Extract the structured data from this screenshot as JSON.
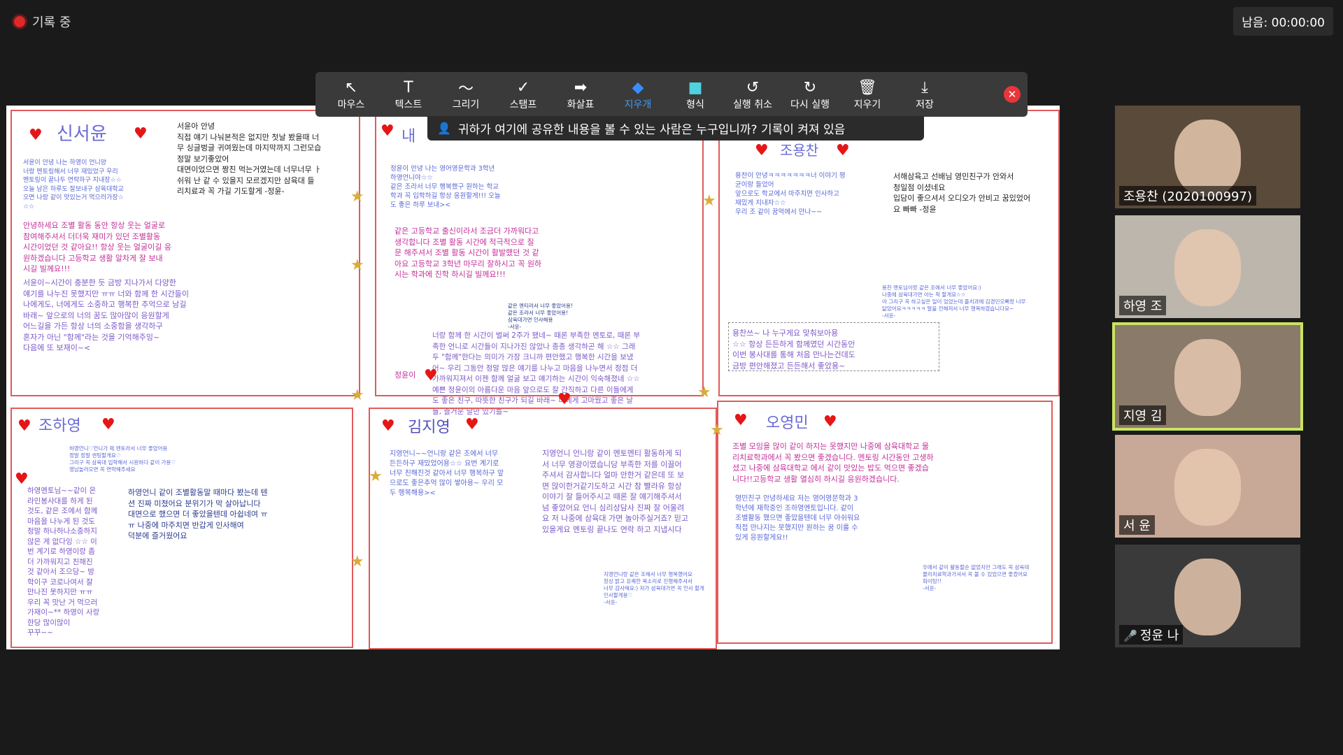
{
  "recording": {
    "label": "기록 중"
  },
  "timer": {
    "label": "남음: 00:00:00"
  },
  "toolbar": {
    "tools": [
      {
        "label": "마우스",
        "glyph": "↖"
      },
      {
        "label": "텍스트",
        "glyph": "T"
      },
      {
        "label": "그리기",
        "glyph": "〜"
      },
      {
        "label": "스탬프",
        "glyph": "✓"
      },
      {
        "label": "화살표",
        "glyph": "➡"
      },
      {
        "label": "지우개",
        "glyph": "◆"
      },
      {
        "label": "형식",
        "glyph": "■"
      },
      {
        "label": "실행 취소",
        "glyph": "↺"
      },
      {
        "label": "다시 실행",
        "glyph": "↻"
      },
      {
        "label": "지우기",
        "glyph": "🗑"
      },
      {
        "label": "저장",
        "glyph": "⤓"
      }
    ],
    "active": "지우개",
    "close_glyph": "✕"
  },
  "share_info": {
    "text": "귀하가 여기에 공유한 내용을 볼 수 있는 사람은 누구입니까? 기록이 켜져 있음"
  },
  "cards": {
    "c1": {
      "name": "신서윤",
      "t_main": "서윤이 안녕 나는 하영이 언니양\n너랑 멘토링해서 너무 재밌었구 우리\n멘토링이 끝나두 연락하구 지내장☆☆\n오늘 남은 하루도 잘보내구 삼육대학교\n오면 나랑 같이 맛있는거 먹으러가장☆\n☆☆",
      "t_top": "서윤아 안녕\n직접 얘기 나눠본적은 없지만 첫날 봤을때 너\n무 싱글벙글 귀여웠는데 마지막까지 그런모습\n정말 보기좋았어\n대면이었으면 짱친 먹는거였는데 너무너무 ㅏ\n쉬워 난 같 수 있을지 모르겠지만 삼육대 들\n리치료과 꼭 가길 기도할게 -정윤-",
      "t_pink": "안녕하세요 조별 활동 동안 항상 웃는 얼굴로\n참여해주셔서 더더욱 재미가 있던 조별활동\n시간이었던 것 같아요!! 항상 웃는 얼굴이길 응\n원하겠습니다 고등학교 생활 알차게 잘 보내\n시길 빌께요!!!",
      "t_purple": "서윤이~시간이 충분한 듯 금방 지나가서 다양한\n얘기를 나누진 못했지만 ㅠㅠ 너와 함께 한 시간들이\n나에게도, 너에게도 소중하고 행복한 추억으로 남길\n바래~ 앞으로의 너의 꿈도 많아많이 응원할게\n어느길을 가든 항상 너의 소중함을 생각하구\n혼자가 아닌 \"함께\"라는 것을 기억해주잉~\n다음에 또 보재이~<"
    },
    "c2": {
      "name": "내",
      "t_blue": "정윤이 안녕 나는 영어영문학과 3학년\n하영언니야☆☆\n같은 조라서 너무 행복했구 원하는 학교\n학과 꼭 입학하길 항상 응원할게!!! 오늘\n도 좋은 하루 보내><",
      "t_pink": "같은 고등학교 출신이라서 조금더 가까워다고\n생각합니다 조별 활동 시간에 적극적으로 질\n문 해주셔서 조별 활동 시간이 활발했던 것 같\n아요 고등학교 3학년 마무리 잘하시고 꼭 원하\n시는 학과에 진학 하시길 빌께요!!!",
      "t_tiny": "같은 멘티라서 너무 좋았어용!\n같은 조라서 너무 좋았어용!\n삼육대가면 인사해용\n-서윤-",
      "t_bottom": "너랑 함께 한 시간이 벌써 2주가 됐네~ 때론 부족한 멘토로, 때론 부\n족한 언니로 시간들이 지나가진 않았나 종종 생각하곤 해 ☆☆ 그래\n두 \"함께\"한다는 의미가 가장 크니까 편안했고 행복한 시간을 보냈\n어~ 우리 그동안 정말 많은 얘기를 나누고 마음을 나누면서 정점 더\n가까워지져서 이젠 함께 얼굴 보고 얘기하는 시간이 익숙해졌네 ☆☆\n예쁜 정윤이의 아름다운 마음 앞으로도 잘 간직하고 다른 이들에게\n도 좋은 친구, 따뜻한 친구가 되길 바래~ 너에게 고마웠고 좋은 날\n들, 즐거운 날만 있기를~",
      "label_jy": "정윤이"
    },
    "c3": {
      "name": "조용찬",
      "t_blue": "용찬이 안녕ㅋㅋㅋㅋㅋㅋㅋ너 이야기 평\n균이랑 들었어\n앞으로도 학교에서 마주치면 인사하고\n재밌게 지내자☆☆\n우리 조 같이 꿈먹에서 만나~~",
      "t_dark": "서해삼육고 선배님 영민친구가 안와서\n청일점 이셨네요\n입담이 좋으셔서 오디오가 안비고 꿈있었어\n요 빠빠 -정윤",
      "t_tiny": "용찬 멘토님이랑 같은 조에서 너무 좋았어요:)\n나중에 삼육대가면 아는 척 할게요☆☆\n아 그리구 꼭 하고싶은 일이 있었는데 졸치과에 김경민오빠랑 너무\n닮았어요ㅋㅋㅋㅋㅋ 말을 전해져서 너무 행복하였습니다요~\n-서윤-",
      "t_purple": "용찬쓰~ 나 누구게요 맞춰보아용\n☆☆ 항상 든든하게 함께였던 시간동안\n이번 봉사대를 통해 처음 만나는건데도\n금방 편안해졌고 든든해서 좋았용~"
    },
    "c4": {
      "name": "조하영",
      "t_tiny": "하영언니♡언니가 제 멘토라서 너무 좋았어용\n정말 정말 엔팅할게요♡\n그리구 꼭 삼육대 입학해서 시원하다 같이 가용♡\n영남놀러오면 꼭 연락해주세요",
      "t_left": "하영멘토님~~같이 온\n라인봉사대를 하게 된\n것도, 같은 조에서 함께\n마음을 나누게 된 것도\n정말 하나하나소중하지\n않은 게 없다잉 ☆☆ 이\n번 계기로 하영이랑 좀\n더 가까워지고 친해진\n것 같아서 조으당~ 방\n학이구 코로나여서 잘\n만나진 못하지만 ㅠㅠ\n우리 꼭 맛난 거 먹으러\n가재이~** 하영이 사랑\n한당 많이많이\n꾸꾸~~",
      "t_right": "하영언니 같이 조별활동말 때마다 봤는데 텐\n션 진짜 미쳤어요 분위기가 막 살아납니다\n대면으로 했으면 더 좋았을텐데 아쉽네여 ㅠ\nㅠ 나중에 마주치면 반갑게 인사해여\n덕분에 즐거웠어요"
    },
    "c5": {
      "name": "김지영",
      "t_blue": "지영언니~~언니랑 같은 조에서 너무\n든든하구 재밌었어용☆☆ 요번 계기로\n너무 친해진것 같아서 너무 행복하구 앞\n으로도 좋은추억 많이 쌓아용~ 우리 모\n두 행복해용><",
      "t_purple": "지영언니 언니랑 같이 멘토멘티 활동하게 되\n서 너무 영광이였습니당 부족한 저를 이끌어\n주셔서 감사합니다 얼마 안한거 같은데 또 보\n면 많이한거같기도하고 시간 참 빨라유 항상\n이야기 잘 들어주시고 때론 잘 얘기해주셔서\n넘 좋았어요 언니 심리상담사 진짜 잘 어울려\n요 저 나중에 삼육대 가면 놀아주실거죠? 믿고\n있을게요 멘토링 끝나도 연락 하고 지냅시다",
      "t_tiny": "지영언니랑 같은 조해서 너무 행복했어요\n항상 밝고 유쾌한 목소리로 진행해주셔서\n너무 감사해요:) 저가 삼육대가면 꼭 인사 할게\n인사할게용♡\n-서윤-"
    },
    "c6": {
      "name": "오영민",
      "t_pink": "조별 모임을 많이 같이 하지는 못했지만 나중에 삼육대학교 물\n리치료학과에서 꼭 봤으면 좋겠습니다. 멘토링 시간동안 고생하\n셨고 나중에 삼육대학교 에서 같이 맛있는 밥도 먹으면 좋겠습\n니다!!고등학교 생활 열심히 하시길 응원하겠습니다.",
      "t_blue": "영민친구 안녕하세요 저는 영어영문학과 3\n학년에 재학중인 조하영멘토입니다. 같이\n조별활동 했으면 좋았을텐데 너무 아쉬워요\n직접 만나지는 못했지만 원하는 꿈 이룰 수\n있게 응원할게요!!",
      "t_tiny": "우에서 같이 활동할순 없었지만 그래도 꼭 삼육대\n물리치료학과가셔서 꼭 볼 수 있었으면 좋겠어요\n화이팅!!\n-서윤-"
    }
  },
  "participants": [
    {
      "name": "조용찬 (2020100997)",
      "muted": false,
      "active": false,
      "bg": "#5a4a3a"
    },
    {
      "name": "하영 조",
      "muted": false,
      "active": false,
      "bg": "#bdb6ad"
    },
    {
      "name": "지영 김",
      "muted": false,
      "active": true,
      "bg": "#8a7a6a"
    },
    {
      "name": "서 윤",
      "muted": false,
      "active": false,
      "bg": "#c8a896"
    },
    {
      "name": "정윤 나",
      "muted": true,
      "active": false,
      "bg": "#3a3a3a"
    }
  ]
}
